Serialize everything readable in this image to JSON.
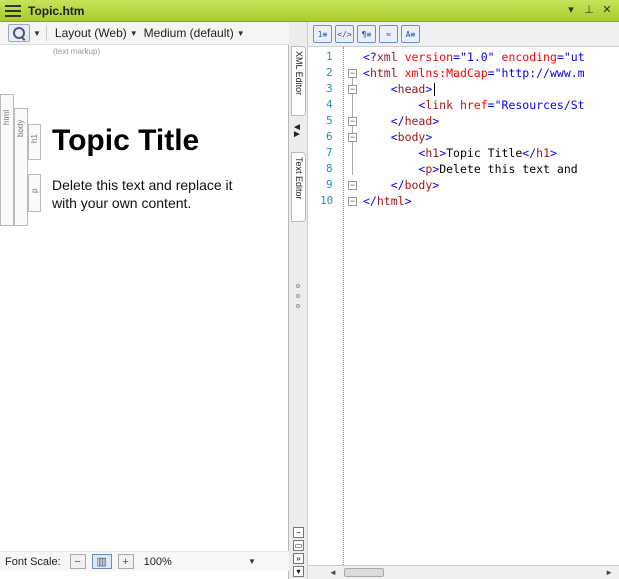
{
  "window": {
    "title": "Topic.htm",
    "controls": [
      "▾",
      "⊥",
      "✕"
    ]
  },
  "left_toolbar": {
    "layout_label": "Layout (Web)",
    "medium_label": "Medium (default)",
    "markup_hint": "(text markup)"
  },
  "structure_bars": [
    "html",
    "body",
    "h1",
    "p"
  ],
  "document": {
    "heading": "Topic Title",
    "paragraph": "Delete this text and replace it with your own content."
  },
  "font_scale": {
    "label": "Font Scale:",
    "minus": "−",
    "plus": "+",
    "value": "100%"
  },
  "side_tabs": {
    "xml_editor": "XML Editor",
    "text_editor": "Text Editor"
  },
  "right_toolbar": {
    "buttons": [
      "1≡",
      "</>",
      "¶≡",
      "≈",
      "A≡"
    ]
  },
  "code": {
    "line_numbers": [
      "1",
      "2",
      "3",
      "4",
      "5",
      "6",
      "7",
      "8",
      "9",
      "10"
    ],
    "lines": [
      {
        "indent": "",
        "parts": [
          {
            "c": "t-punct",
            "t": "<?"
          },
          {
            "c": "t-tag",
            "t": "xml"
          },
          {
            "c": "t-attr",
            "t": " version"
          },
          {
            "c": "t-punct",
            "t": "="
          },
          {
            "c": "t-val",
            "t": "\"1.0\""
          },
          {
            "c": "t-attr",
            "t": " encoding"
          },
          {
            "c": "t-punct",
            "t": "="
          },
          {
            "c": "t-val",
            "t": "\"ut"
          }
        ]
      },
      {
        "indent": "",
        "parts": [
          {
            "c": "t-punct",
            "t": "<"
          },
          {
            "c": "t-tag",
            "t": "html"
          },
          {
            "c": "t-attr",
            "t": " xmlns:MadCap"
          },
          {
            "c": "t-punct",
            "t": "="
          },
          {
            "c": "t-val",
            "t": "\"http://www.m"
          }
        ]
      },
      {
        "indent": "    ",
        "parts": [
          {
            "c": "t-punct",
            "t": "<"
          },
          {
            "c": "t-tag",
            "t": "head"
          },
          {
            "c": "t-punct",
            "t": ">"
          }
        ]
      },
      {
        "indent": "        ",
        "parts": [
          {
            "c": "t-punct",
            "t": "<"
          },
          {
            "c": "t-tag",
            "t": "link"
          },
          {
            "c": "t-attr",
            "t": " href"
          },
          {
            "c": "t-punct",
            "t": "="
          },
          {
            "c": "t-val",
            "t": "\"Resources/St"
          }
        ]
      },
      {
        "indent": "    ",
        "parts": [
          {
            "c": "t-punct",
            "t": "</"
          },
          {
            "c": "t-tag",
            "t": "head"
          },
          {
            "c": "t-punct",
            "t": ">"
          }
        ]
      },
      {
        "indent": "    ",
        "parts": [
          {
            "c": "t-punct",
            "t": "<"
          },
          {
            "c": "t-tag",
            "t": "body"
          },
          {
            "c": "t-punct",
            "t": ">"
          }
        ]
      },
      {
        "indent": "        ",
        "parts": [
          {
            "c": "t-punct",
            "t": "<"
          },
          {
            "c": "t-tag",
            "t": "h1"
          },
          {
            "c": "t-punct",
            "t": ">"
          },
          {
            "c": "t-text",
            "t": "Topic Title"
          },
          {
            "c": "t-punct",
            "t": "</"
          },
          {
            "c": "t-tag",
            "t": "h1"
          },
          {
            "c": "t-punct",
            "t": ">"
          }
        ]
      },
      {
        "indent": "        ",
        "parts": [
          {
            "c": "t-punct",
            "t": "<"
          },
          {
            "c": "t-tag",
            "t": "p"
          },
          {
            "c": "t-punct",
            "t": ">"
          },
          {
            "c": "t-text",
            "t": "Delete this text and"
          }
        ]
      },
      {
        "indent": "    ",
        "parts": [
          {
            "c": "t-punct",
            "t": "</"
          },
          {
            "c": "t-tag",
            "t": "body"
          },
          {
            "c": "t-punct",
            "t": ">"
          }
        ]
      },
      {
        "indent": "",
        "parts": [
          {
            "c": "t-punct",
            "t": "</"
          },
          {
            "c": "t-tag",
            "t": "html"
          },
          {
            "c": "t-punct",
            "t": ">"
          }
        ]
      }
    ]
  }
}
